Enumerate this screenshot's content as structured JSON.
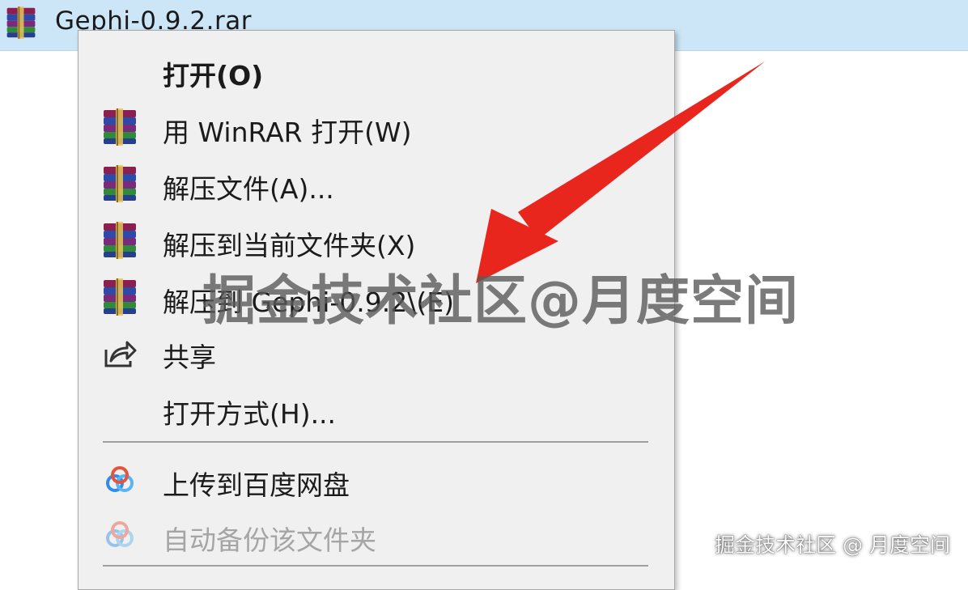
{
  "file": {
    "name": "Gephi-0.9.2.rar",
    "icon": "winrar-archive-icon"
  },
  "menu": {
    "items": [
      {
        "label": "打开(O)",
        "icon": "",
        "bold": true,
        "enabled": true
      },
      {
        "label": "用 WinRAR 打开(W)",
        "icon": "winrar-icon",
        "enabled": true
      },
      {
        "label": "解压文件(A)...",
        "icon": "winrar-icon",
        "enabled": true
      },
      {
        "label": "解压到当前文件夹(X)",
        "icon": "winrar-icon",
        "enabled": true
      },
      {
        "label": "解压到 Gephi-0.9.2\\(E)",
        "icon": "winrar-icon",
        "enabled": true
      },
      {
        "label": "共享",
        "icon": "share-icon",
        "enabled": true
      },
      {
        "label": "打开方式(H)...",
        "icon": "",
        "enabled": true
      },
      {
        "label": "上传到百度网盘",
        "icon": "baidu-netdisk-icon",
        "enabled": true
      },
      {
        "label": "自动备份该文件夹",
        "icon": "baidu-netdisk-icon",
        "enabled": false
      }
    ]
  },
  "overlay": {
    "watermark": "掘金技术社区@月度空间",
    "credit": "掘金技术社区 @ 月度空间",
    "arrow_color": "#e8261d"
  },
  "colors": {
    "selection_bg": "#cde6f7",
    "menu_bg": "#f0f0f0",
    "disabled_text": "#a5a5a5"
  }
}
